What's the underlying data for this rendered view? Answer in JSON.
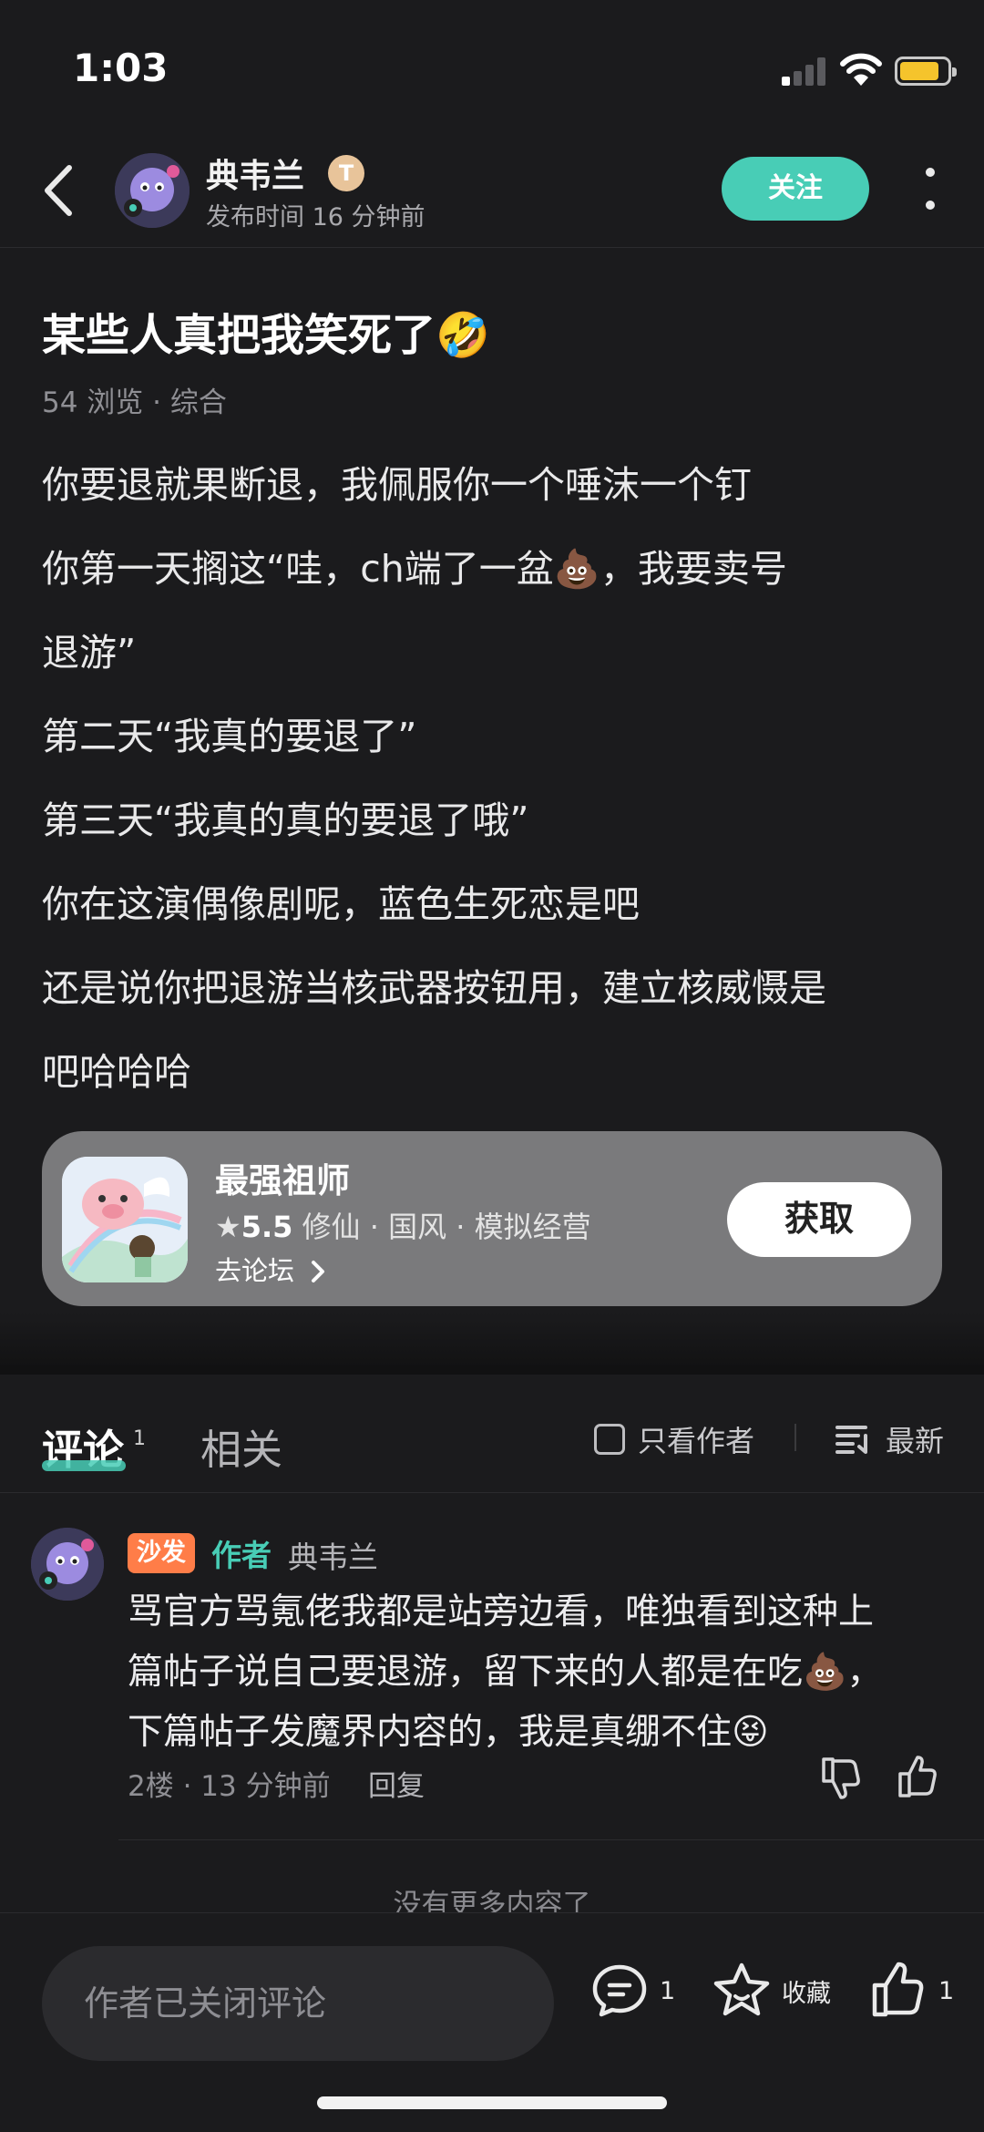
{
  "status": {
    "time": "1:03"
  },
  "header": {
    "author_name": "典韦兰",
    "badge_letter": "T",
    "post_time": "发布时间 16 分钟前",
    "follow_label": "关注"
  },
  "post": {
    "title": "某些人真把我笑死了🤣",
    "meta": "54 浏览 · 综合",
    "lines": [
      "你要退就果断退，我佩服你一个唾沫一个钉",
      "你第一天搁这“哇，ch端了一盆💩，我要卖号",
      "退游”",
      "第二天“我真的要退了”",
      "第三天“我真的真的要退了哦”",
      "你在这演偶像剧呢，蓝色生死恋是吧",
      "还是说你把退游当核武器按钮用，建立核威慑是",
      "吧哈哈哈"
    ]
  },
  "game_card": {
    "name": "最强祖师",
    "star": "★",
    "rating": "5.5",
    "tags": " 修仙 · 国风 · 模拟经营",
    "forum_link": "去论坛",
    "get_label": "获取"
  },
  "tabs": {
    "comments_label": "评论",
    "comments_count": "1",
    "related_label": "相关",
    "author_only_label": "只看作者",
    "sort_label": "最新"
  },
  "comment": {
    "sofa_badge": "沙发",
    "author_tag": "作者",
    "name": "典韦兰",
    "lines": [
      "骂官方骂氪佬我都是站旁边看，唯独看到这种上",
      "篇帖子说自己要退游，留下来的人都是在吃💩，",
      "下篇帖子发魔界内容的，我是真绷不住😝"
    ],
    "meta": "2楼 · 13 分钟前",
    "reply_label": "回复"
  },
  "footer": {
    "no_more": "没有更多内容了",
    "input_placeholder": "作者已关闭评论",
    "comment_count": "1",
    "favorite_label": "收藏",
    "like_count": "1"
  },
  "colors": {
    "accent": "#48cdb6",
    "background": "#1b1b1d",
    "sofa_badge": "#ff7d48",
    "card": "#7a7a7c"
  },
  "icons": [
    "back-arrow-icon",
    "more-dots-icon",
    "checkbox-icon",
    "sort-lines-icon",
    "thumbs-down-icon",
    "thumbs-up-icon",
    "comment-bubble-icon",
    "star-icon",
    "chevron-right-icon"
  ]
}
